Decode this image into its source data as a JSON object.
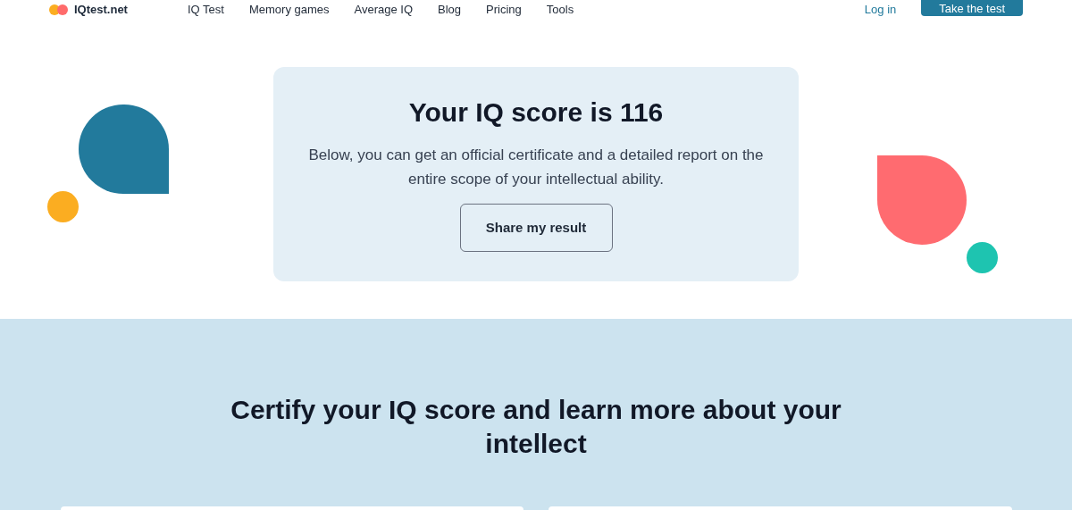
{
  "header": {
    "logo": "IQtest.net",
    "nav": [
      "IQ Test",
      "Memory games",
      "Average IQ",
      "Blog",
      "Pricing",
      "Tools"
    ],
    "login": "Log in",
    "cta": "Take the test"
  },
  "result": {
    "title": "Your IQ score is 116",
    "text": "Below, you can get an official certificate and a detailed report on the entire scope of your intellectual ability.",
    "button": "Share my result"
  },
  "certify": {
    "heading": "Certify your IQ score and learn more about your intellect"
  }
}
